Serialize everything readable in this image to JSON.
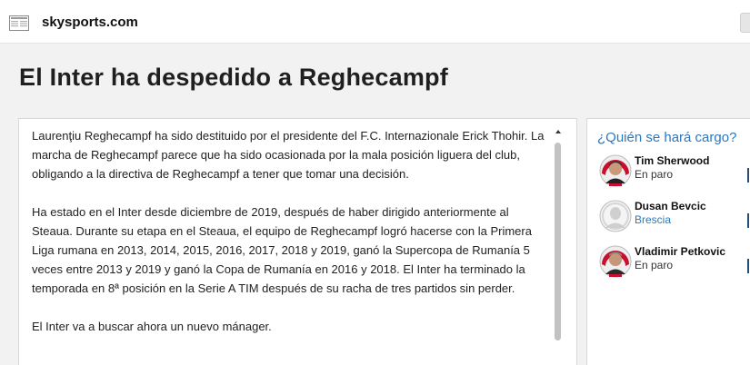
{
  "topbar": {
    "site": "skysports.com",
    "icon": "reader-view-icon"
  },
  "article": {
    "title": "El Inter ha despedido a Reghecampf",
    "paragraphs": [
      "Laurenţiu Reghecampf ha sido destituido por el presidente del F.C. Internazionale Erick Thohir. La marcha de Reghecampf parece que ha sido ocasionada por la mala posición liguera del club, obligando a la directiva de Reghecampf a tener que tomar una decisión.",
      "Ha estado en el Inter desde diciembre de 2019, después de haber dirigido anteriormente al Steaua. Durante su etapa en el Steaua, el equipo de Reghecampf logró hacerse con la Primera Liga rumana en 2013, 2014, 2015, 2016, 2017, 2018 y 2019, ganó la Supercopa de Rumanía 5 veces entre 2013 y 2019 y ganó la Copa de Rumanía en 2016 y 2018. El Inter ha terminado la temporada en 8ª posición en la Serie A TIM después de su racha de tres partidos sin perder.",
      "El Inter va a buscar ahora un nuevo mánager."
    ]
  },
  "sidebar": {
    "title": "¿Quién se hará cargo?",
    "candidates": [
      {
        "name": "Tim Sherwood",
        "status": "En paro"
      },
      {
        "name": "Dusan Bevcic",
        "status": "Brescia"
      },
      {
        "name": "Vladimir Petkovic",
        "status": "En paro"
      }
    ]
  },
  "colors": {
    "accent": "#2a78c2",
    "badge_red": "#c8102e"
  }
}
